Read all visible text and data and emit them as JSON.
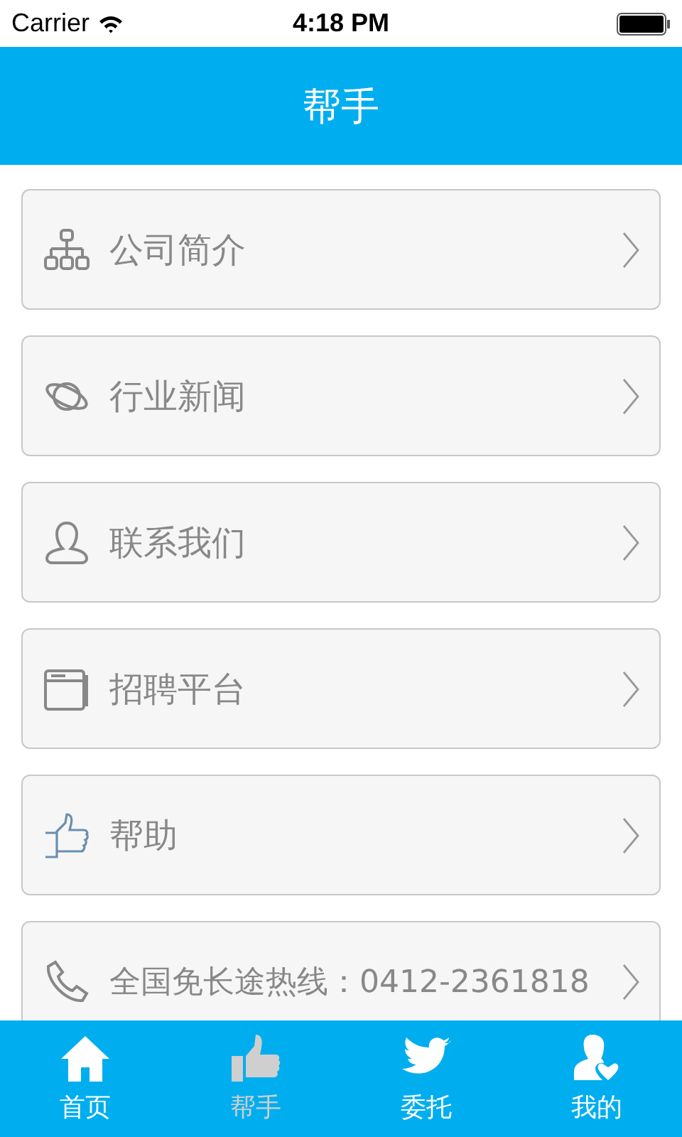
{
  "status_bar": {
    "carrier": "Carrier",
    "time": "4:18 PM"
  },
  "header": {
    "title": "帮手"
  },
  "menu": [
    {
      "kind": "org",
      "label": "公司简介"
    },
    {
      "kind": "planet",
      "label": "行业新闻"
    },
    {
      "kind": "person",
      "label": "联系我们"
    },
    {
      "kind": "window",
      "label": "招聘平台"
    },
    {
      "kind": "thumb",
      "label": "帮助"
    },
    {
      "kind": "phone",
      "label": "全国免长途热线：0412-2361818"
    }
  ],
  "tabs": [
    {
      "kind": "home",
      "label": "首页",
      "selected": false
    },
    {
      "kind": "thumb",
      "label": "帮手",
      "selected": true
    },
    {
      "kind": "bird",
      "label": "委托",
      "selected": false
    },
    {
      "kind": "user",
      "label": "我的",
      "selected": false
    }
  ]
}
